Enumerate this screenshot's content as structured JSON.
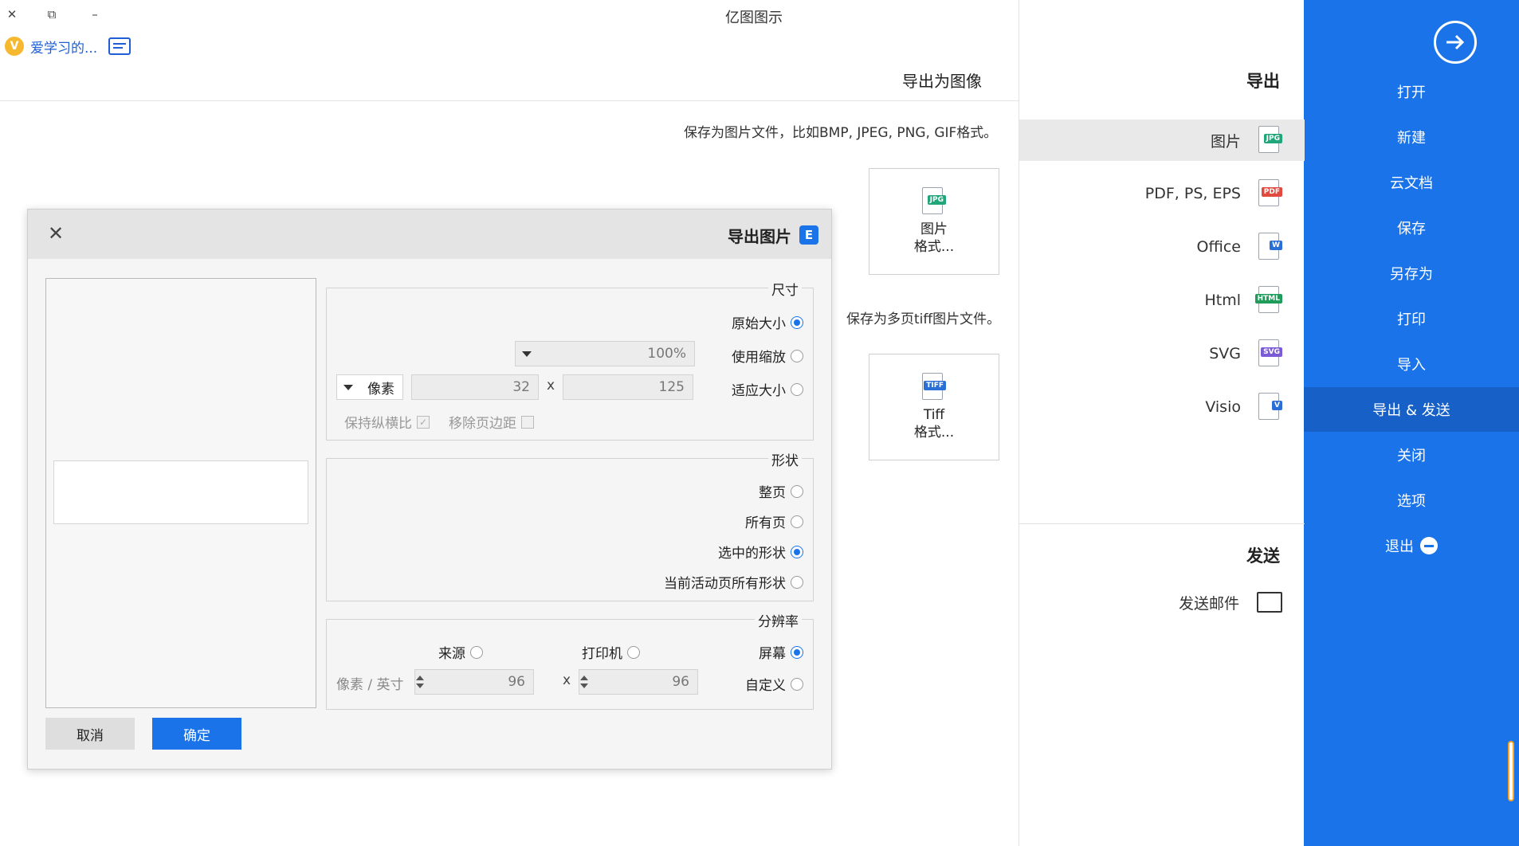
{
  "app": {
    "title": "亿图图示",
    "window_controls": {
      "close": "✕",
      "restore": "⧉",
      "minimize": "–"
    },
    "user_label": "爱学习的...",
    "vip_badge": "V",
    "feedback_icon": "feedback-icon"
  },
  "sidebar": {
    "items": [
      {
        "label": "打开"
      },
      {
        "label": "新建"
      },
      {
        "label": "云文档"
      },
      {
        "label": "保存"
      },
      {
        "label": "另存为"
      },
      {
        "label": "打印"
      },
      {
        "label": "导入"
      },
      {
        "label": "导出 & 发送"
      },
      {
        "label": "关闭"
      },
      {
        "label": "选项"
      },
      {
        "label": "退出"
      }
    ],
    "active": "导出 & 发送",
    "colors": {
      "background": "#1a73e8",
      "active": "#1660c8"
    }
  },
  "export_panel": {
    "heading": "导出",
    "items": [
      {
        "label": "图片",
        "tag": "JPG",
        "tag_color": "#21a67a"
      },
      {
        "label": "PDF, PS, EPS",
        "tag": "PDF",
        "tag_color": "#e04a3f"
      },
      {
        "label": "Office",
        "tag": "W",
        "tag_color": "#2b6fd6"
      },
      {
        "label": "Html",
        "tag": "HTML",
        "tag_color": "#1f9c5a"
      },
      {
        "label": "SVG",
        "tag": "SVG",
        "tag_color": "#7b5cd6"
      },
      {
        "label": "Visio",
        "tag": "V",
        "tag_color": "#2b6fd6"
      }
    ],
    "send_heading": "发送",
    "send_items": [
      {
        "label": "发送邮件"
      }
    ]
  },
  "main": {
    "title": "导出为图像",
    "desc1": "保存为图片文件，比如BMP, JPEG, PNG, GIF格式。",
    "card1": {
      "line1": "图片",
      "line2": "格式...",
      "tag": "JPG"
    },
    "desc2": "保存为多页tiff图片文件。",
    "card2": {
      "line1": "Tiff",
      "line2": "格式...",
      "tag": "TIFF"
    }
  },
  "dialog": {
    "title": "导出图片",
    "logo": "E",
    "close": "✕",
    "size": {
      "legend": "尺寸",
      "original": "原始大小",
      "zoom": "使用缩放",
      "zoom_value": "100%",
      "fit": "适应大小",
      "width": "125",
      "height": "32",
      "x": "x",
      "unit": "像素",
      "remove_margin": "移除页边距",
      "keep_ratio": "保持纵横比",
      "selected": "原始大小"
    },
    "shape": {
      "legend": "形状",
      "options": [
        "整页",
        "所有页",
        "选中的形状",
        "当前活动页所有形状"
      ],
      "selected": "选中的形状"
    },
    "resolution": {
      "legend": "分辨率",
      "screen": "屏幕",
      "printer": "打印机",
      "source": "来源",
      "custom": "自定义",
      "dpi_x": "96",
      "dpi_y": "96",
      "x": "x",
      "unit": "像素 / 英寸",
      "selected": "屏幕"
    },
    "ok": "确定",
    "cancel": "取消"
  }
}
